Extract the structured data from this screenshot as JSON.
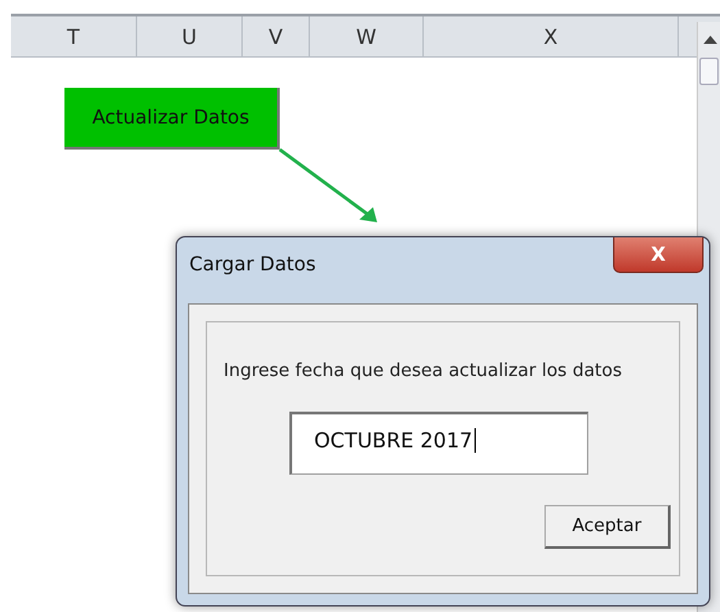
{
  "sheet": {
    "columns": [
      {
        "label": "T"
      },
      {
        "label": "U"
      },
      {
        "label": "V"
      },
      {
        "label": "W"
      },
      {
        "label": "X"
      }
    ],
    "macro_button": {
      "label": "Actualizar Datos"
    }
  },
  "dialog": {
    "title": "Cargar Datos",
    "close_label": "X",
    "prompt": "Ingrese fecha que desea actualizar los datos",
    "input_value": "OCTUBRE 2017",
    "ok_button": "Aceptar"
  }
}
